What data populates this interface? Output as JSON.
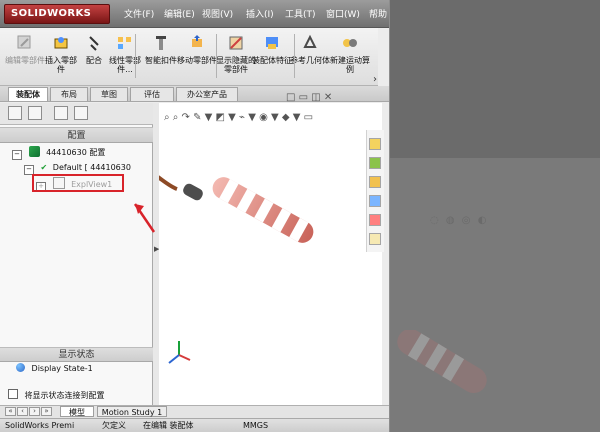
{
  "app": {
    "logo": "SOLIDWORKS"
  },
  "menu": [
    "文件(F)",
    "编辑(E)",
    "视图(V)",
    "插入(I)",
    "工具(T)",
    "窗口(W)",
    "帮助"
  ],
  "toolbar": [
    "编辑零部件",
    "插入零部件",
    "配合",
    "线性零部件...",
    "智能扣件",
    "移动零部件",
    "显示隐藏的零部件",
    "装配体特征",
    "参考几何体",
    "新建运动算例"
  ],
  "tabs": [
    "装配体",
    "布局",
    "草图",
    "评估",
    "办公室产品"
  ],
  "left_panel": {
    "header": "配置",
    "tree": [
      "44410630 配置",
      "Default [ 44410630",
      "ExplView1"
    ],
    "display_state_header": "显示状态",
    "display_state": "Display State-1",
    "link_option": "将显示状态连接到配置"
  },
  "bottom_tabs": [
    "模型",
    "Motion Study 1"
  ],
  "status": {
    "product": "SolidWorks Premi",
    "state1": "欠定义",
    "state2": "在编辑 装配体",
    "units": "MMGS"
  },
  "icons": {
    "title_close": "close-icon",
    "panel_toggle": "chevron-right-icon",
    "task_pane": [
      "home-icon",
      "parts-library-icon",
      "folder-icon",
      "document-icon",
      "appearance-icon",
      "notes-icon"
    ]
  },
  "colors": {
    "titlebar": "#7d7d7d",
    "brand": "#9f1d1d",
    "highlight": "#d8232a"
  }
}
